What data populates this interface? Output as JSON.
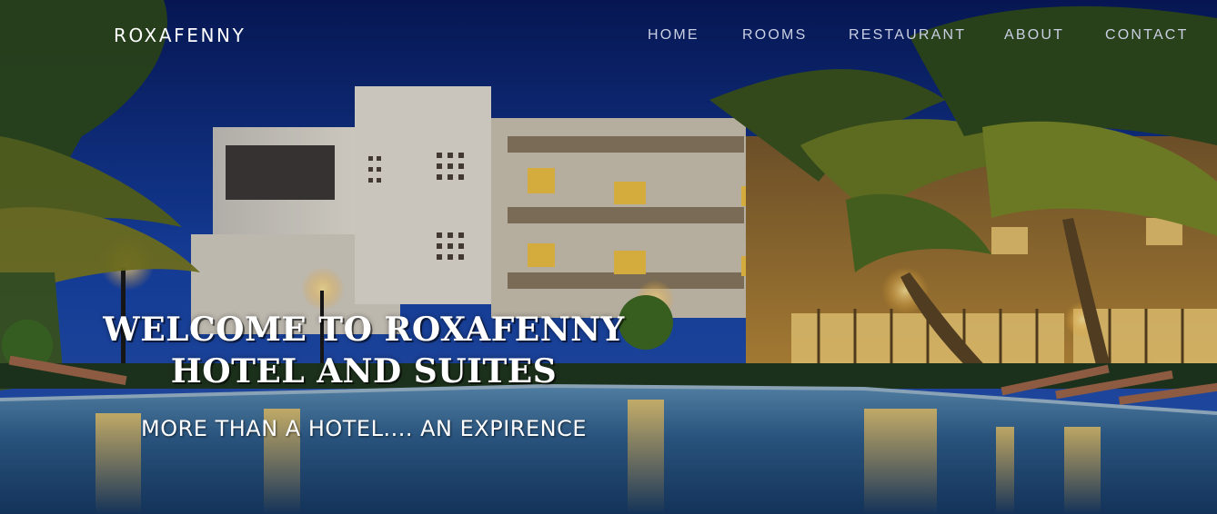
{
  "brand": {
    "name": "ROXAFENNY"
  },
  "nav": {
    "items": [
      {
        "label": "HOME"
      },
      {
        "label": "ROOMS"
      },
      {
        "label": "RESTAURANT"
      },
      {
        "label": "ABOUT"
      },
      {
        "label": "CONTACT"
      }
    ]
  },
  "hero": {
    "title_line1": "WELCOME TO ROXAFENNY",
    "title_line2": "HOTEL AND SUITES",
    "subtitle": "MORE THAN A HOTEL.... AN EXPIRENCE"
  },
  "colors": {
    "nav_link": "#c9cfe3",
    "brand": "#ffffff",
    "sky": "#0d2a7a",
    "pool": "#3a6d9a"
  }
}
